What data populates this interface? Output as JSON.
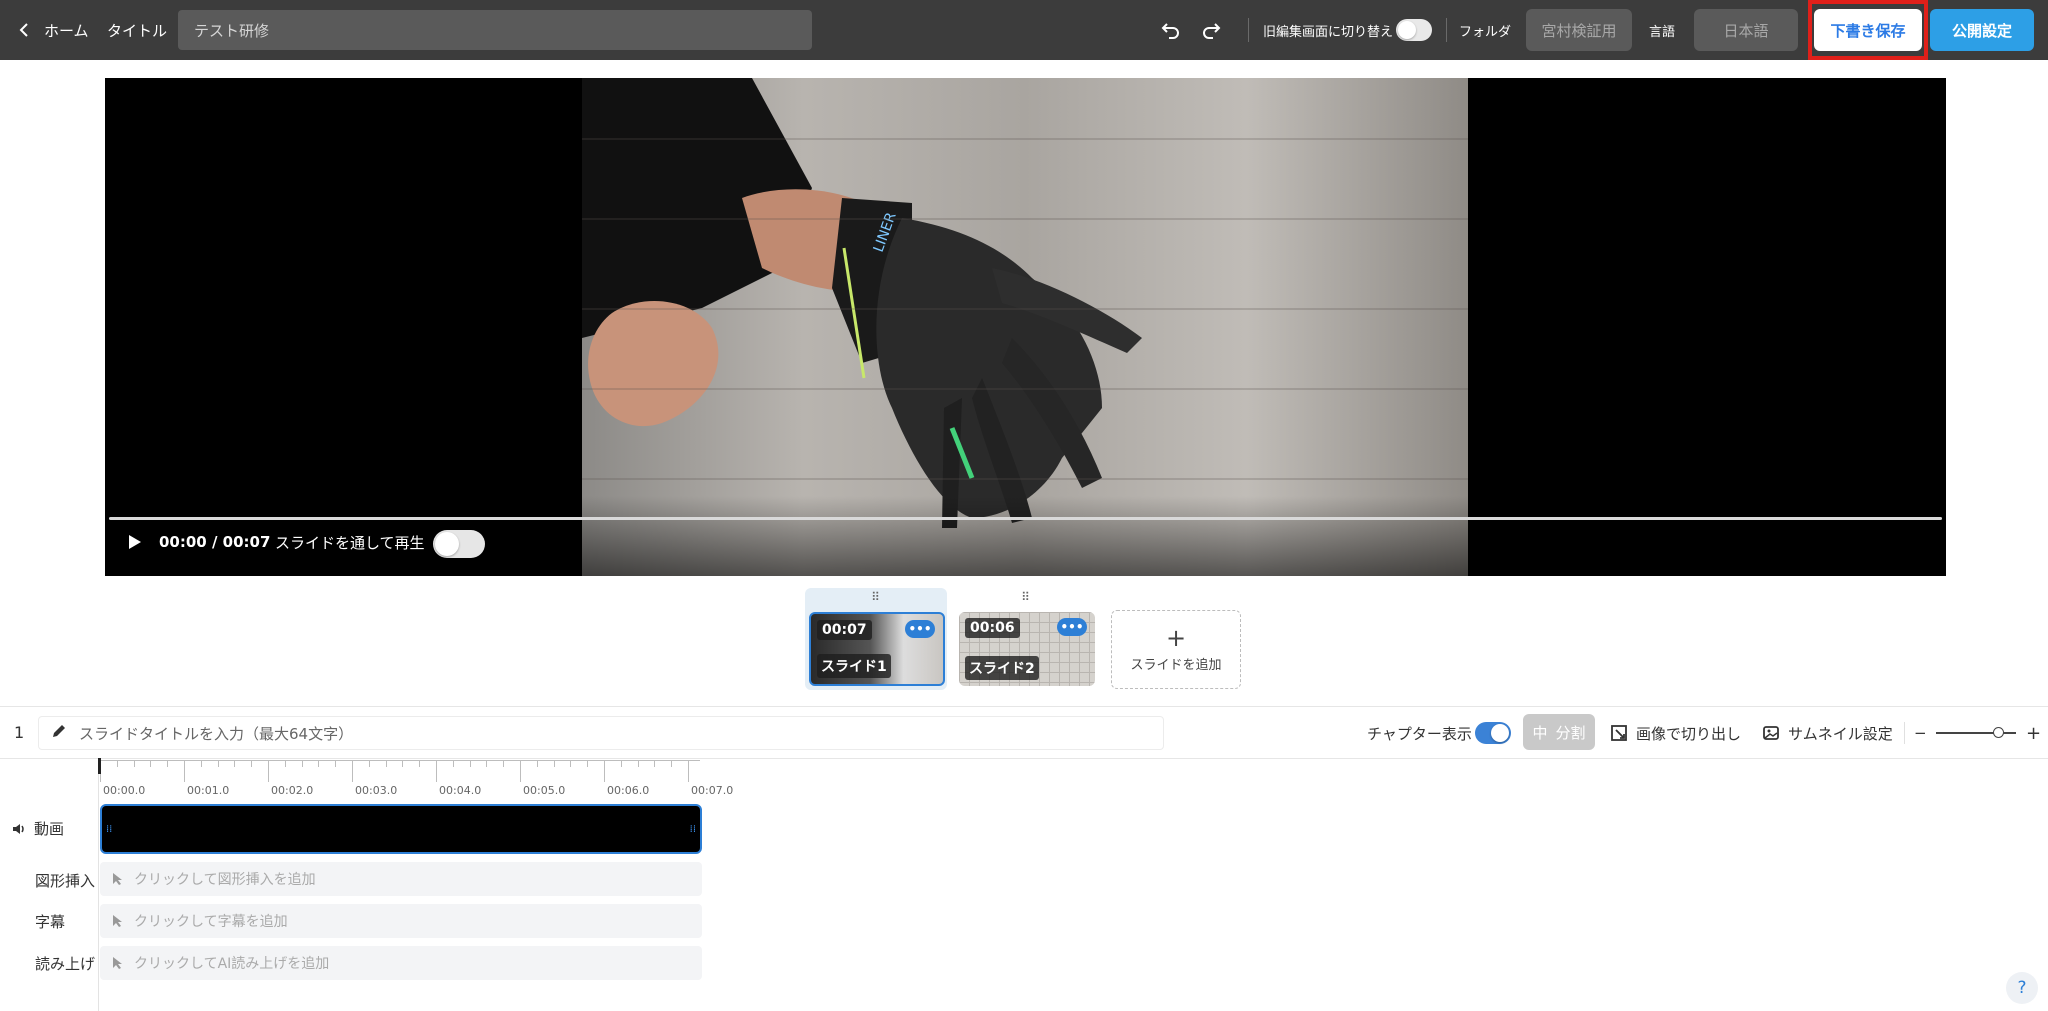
{
  "topbar": {
    "home_label": "ホーム",
    "title_label": "タイトル",
    "title_value": "テスト研修",
    "legacy_editor_label": "旧編集画面に切り替え",
    "folder_label": "フォルダ",
    "folder_value": "宮村検証用",
    "language_label": "言語",
    "language_value": "日本語",
    "save_draft_label": "下書き保存",
    "publish_settings_label": "公開設定"
  },
  "player": {
    "time": "00:00 / 00:07",
    "play_through_label": "スライドを通して再生"
  },
  "slides": [
    {
      "duration": "00:07",
      "label": "スライド1",
      "more": "•••"
    },
    {
      "duration": "00:06",
      "label": "スライド2",
      "more": "•••"
    }
  ],
  "add_slide": {
    "icon": "+",
    "label": "スライドを追加"
  },
  "slide_editor": {
    "number": "1",
    "title_placeholder": "スライドタイトルを入力（最大64文字）",
    "chapter_label": "チャプター表示",
    "split_icon": "中",
    "split_label": "分割",
    "crop_image_label": "画像で切り出し",
    "thumbnail_label": "サムネイル設定",
    "zoom_minus": "−",
    "zoom_plus": "+"
  },
  "timeline": {
    "ticks": [
      "00:00.0",
      "00:01.0",
      "00:02.0",
      "00:03.0",
      "00:04.0",
      "00:05.0",
      "00:06.0",
      "00:07.0"
    ],
    "tracks": {
      "video": "動画",
      "shape": "図形挿入",
      "subtitle": "字幕",
      "narration": "読み上げ"
    },
    "shape_placeholder": "クリックして図形挿入を追加",
    "subtitle_placeholder": "クリックして字幕を追加",
    "narration_placeholder": "クリックしてAI読み上げを追加",
    "grip": "⁞⁞"
  },
  "help": "?",
  "colors": {
    "accent": "#2d7fd6",
    "publish": "#2d9fe6",
    "highlight": "#e0201a",
    "topbar": "#3c3c3c"
  }
}
